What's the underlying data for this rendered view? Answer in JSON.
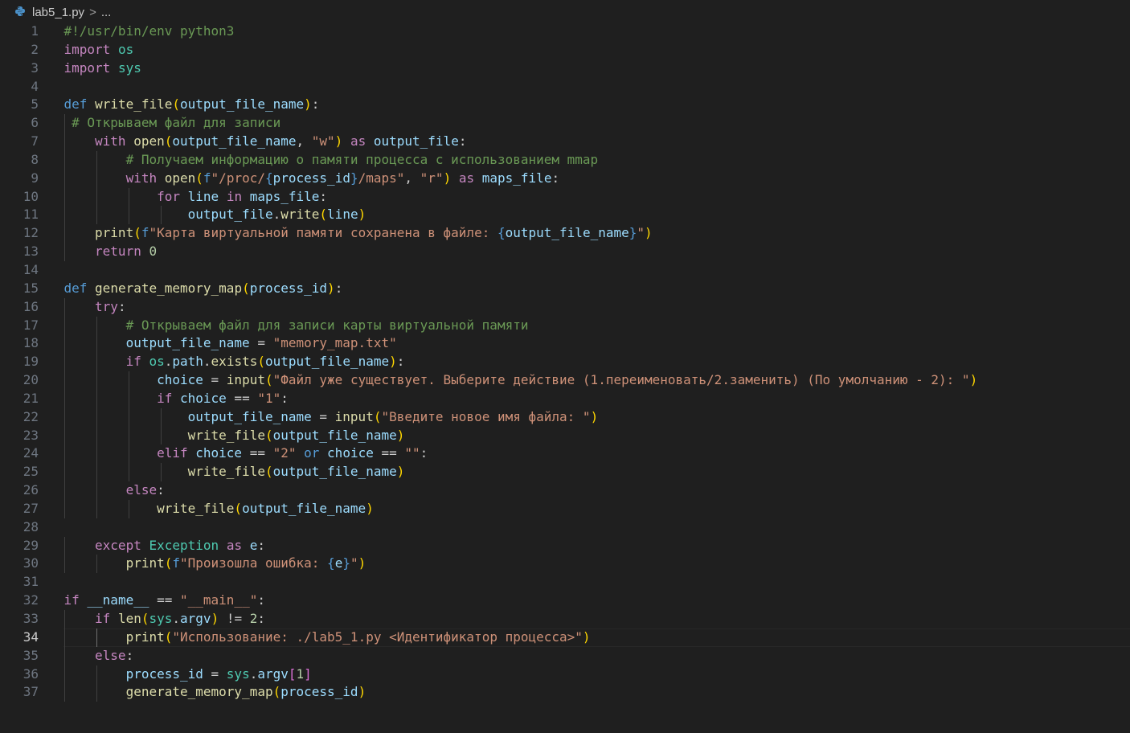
{
  "breadcrumb": {
    "file": "lab5_1.py",
    "sep": ">",
    "more": "..."
  },
  "active_line": 34,
  "lines": [
    {
      "n": "1",
      "indent": 0,
      "t": [
        [
          "c",
          "#!/usr/bin/env python3"
        ]
      ]
    },
    {
      "n": "2",
      "indent": 0,
      "t": [
        [
          "kc",
          "import"
        ],
        [
          "p",
          " "
        ],
        [
          "t",
          "os"
        ]
      ]
    },
    {
      "n": "3",
      "indent": 0,
      "t": [
        [
          "kc",
          "import"
        ],
        [
          "p",
          " "
        ],
        [
          "t",
          "sys"
        ]
      ]
    },
    {
      "n": "4",
      "indent": 0,
      "t": []
    },
    {
      "n": "5",
      "indent": 0,
      "t": [
        [
          "k",
          "def"
        ],
        [
          "p",
          " "
        ],
        [
          "f",
          "write_file"
        ],
        [
          "b1",
          "("
        ],
        [
          "v",
          "output_file_name"
        ],
        [
          "b1",
          ")"
        ],
        [
          "p",
          ":"
        ]
      ]
    },
    {
      "n": "6",
      "indent": 1,
      "t": [
        [
          "p",
          " "
        ],
        [
          "c",
          "# Открываем файл для записи"
        ]
      ]
    },
    {
      "n": "7",
      "indent": 1,
      "t": [
        [
          "p",
          "    "
        ],
        [
          "kc",
          "with"
        ],
        [
          "p",
          " "
        ],
        [
          "f",
          "open"
        ],
        [
          "b1",
          "("
        ],
        [
          "v",
          "output_file_name"
        ],
        [
          "p",
          ", "
        ],
        [
          "s",
          "\"w\""
        ],
        [
          "b1",
          ")"
        ],
        [
          "p",
          " "
        ],
        [
          "kc",
          "as"
        ],
        [
          "p",
          " "
        ],
        [
          "v",
          "output_file"
        ],
        [
          "p",
          ":"
        ]
      ]
    },
    {
      "n": "8",
      "indent": 2,
      "t": [
        [
          "p",
          "        "
        ],
        [
          "c",
          "# Получаем информацию о памяти процесса с использованием mmap"
        ]
      ]
    },
    {
      "n": "9",
      "indent": 2,
      "t": [
        [
          "p",
          "        "
        ],
        [
          "kc",
          "with"
        ],
        [
          "p",
          " "
        ],
        [
          "f",
          "open"
        ],
        [
          "b1",
          "("
        ],
        [
          "k",
          "f"
        ],
        [
          "s",
          "\"/proc/"
        ],
        [
          "sb",
          "{"
        ],
        [
          "v",
          "process_id"
        ],
        [
          "sb",
          "}"
        ],
        [
          "s",
          "/maps\""
        ],
        [
          "p",
          ", "
        ],
        [
          "s",
          "\"r\""
        ],
        [
          "b1",
          ")"
        ],
        [
          "p",
          " "
        ],
        [
          "kc",
          "as"
        ],
        [
          "p",
          " "
        ],
        [
          "v",
          "maps_file"
        ],
        [
          "p",
          ":"
        ]
      ]
    },
    {
      "n": "10",
      "indent": 3,
      "t": [
        [
          "p",
          "            "
        ],
        [
          "kc",
          "for"
        ],
        [
          "p",
          " "
        ],
        [
          "v",
          "line"
        ],
        [
          "p",
          " "
        ],
        [
          "kc",
          "in"
        ],
        [
          "p",
          " "
        ],
        [
          "v",
          "maps_file"
        ],
        [
          "p",
          ":"
        ]
      ]
    },
    {
      "n": "11",
      "indent": 4,
      "t": [
        [
          "p",
          "                "
        ],
        [
          "v",
          "output_file"
        ],
        [
          "p",
          "."
        ],
        [
          "f",
          "write"
        ],
        [
          "b1",
          "("
        ],
        [
          "v",
          "line"
        ],
        [
          "b1",
          ")"
        ]
      ]
    },
    {
      "n": "12",
      "indent": 1,
      "t": [
        [
          "p",
          "    "
        ],
        [
          "f",
          "print"
        ],
        [
          "b1",
          "("
        ],
        [
          "k",
          "f"
        ],
        [
          "s",
          "\"Карта виртуальной памяти сохранена в файле: "
        ],
        [
          "sb",
          "{"
        ],
        [
          "v",
          "output_file_name"
        ],
        [
          "sb",
          "}"
        ],
        [
          "s",
          "\""
        ],
        [
          "b1",
          ")"
        ]
      ]
    },
    {
      "n": "13",
      "indent": 1,
      "t": [
        [
          "p",
          "    "
        ],
        [
          "kc",
          "return"
        ],
        [
          "p",
          " "
        ],
        [
          "n",
          "0"
        ]
      ]
    },
    {
      "n": "14",
      "indent": 0,
      "t": []
    },
    {
      "n": "15",
      "indent": 0,
      "t": [
        [
          "k",
          "def"
        ],
        [
          "p",
          " "
        ],
        [
          "f",
          "generate_memory_map"
        ],
        [
          "b1",
          "("
        ],
        [
          "v",
          "process_id"
        ],
        [
          "b1",
          ")"
        ],
        [
          "p",
          ":"
        ]
      ]
    },
    {
      "n": "16",
      "indent": 1,
      "t": [
        [
          "p",
          "    "
        ],
        [
          "kc",
          "try"
        ],
        [
          "p",
          ":"
        ]
      ]
    },
    {
      "n": "17",
      "indent": 2,
      "t": [
        [
          "p",
          "        "
        ],
        [
          "c",
          "# Открываем файл для записи карты виртуальной памяти"
        ]
      ]
    },
    {
      "n": "18",
      "indent": 2,
      "t": [
        [
          "p",
          "        "
        ],
        [
          "v",
          "output_file_name"
        ],
        [
          "p",
          " = "
        ],
        [
          "s",
          "\"memory_map.txt\""
        ]
      ]
    },
    {
      "n": "19",
      "indent": 2,
      "t": [
        [
          "p",
          "        "
        ],
        [
          "kc",
          "if"
        ],
        [
          "p",
          " "
        ],
        [
          "t",
          "os"
        ],
        [
          "p",
          "."
        ],
        [
          "v",
          "path"
        ],
        [
          "p",
          "."
        ],
        [
          "f",
          "exists"
        ],
        [
          "b1",
          "("
        ],
        [
          "v",
          "output_file_name"
        ],
        [
          "b1",
          ")"
        ],
        [
          "p",
          ":"
        ]
      ]
    },
    {
      "n": "20",
      "indent": 3,
      "t": [
        [
          "p",
          "            "
        ],
        [
          "v",
          "choice"
        ],
        [
          "p",
          " = "
        ],
        [
          "f",
          "input"
        ],
        [
          "b1",
          "("
        ],
        [
          "s",
          "\"Файл уже существует. Выберите действие (1.переименовать/2.заменить) (По умолчанию - 2): \""
        ],
        [
          "b1",
          ")"
        ]
      ]
    },
    {
      "n": "21",
      "indent": 3,
      "t": [
        [
          "p",
          "            "
        ],
        [
          "kc",
          "if"
        ],
        [
          "p",
          " "
        ],
        [
          "v",
          "choice"
        ],
        [
          "p",
          " == "
        ],
        [
          "s",
          "\"1\""
        ],
        [
          "p",
          ":"
        ]
      ]
    },
    {
      "n": "22",
      "indent": 4,
      "t": [
        [
          "p",
          "                "
        ],
        [
          "v",
          "output_file_name"
        ],
        [
          "p",
          " = "
        ],
        [
          "f",
          "input"
        ],
        [
          "b1",
          "("
        ],
        [
          "s",
          "\"Введите новое имя файла: \""
        ],
        [
          "b1",
          ")"
        ]
      ]
    },
    {
      "n": "23",
      "indent": 4,
      "t": [
        [
          "p",
          "                "
        ],
        [
          "f",
          "write_file"
        ],
        [
          "b1",
          "("
        ],
        [
          "v",
          "output_file_name"
        ],
        [
          "b1",
          ")"
        ]
      ]
    },
    {
      "n": "24",
      "indent": 3,
      "t": [
        [
          "p",
          "            "
        ],
        [
          "kc",
          "elif"
        ],
        [
          "p",
          " "
        ],
        [
          "v",
          "choice"
        ],
        [
          "p",
          " == "
        ],
        [
          "s",
          "\"2\""
        ],
        [
          "p",
          " "
        ],
        [
          "k",
          "or"
        ],
        [
          "p",
          " "
        ],
        [
          "v",
          "choice"
        ],
        [
          "p",
          " == "
        ],
        [
          "s",
          "\"\""
        ],
        [
          "p",
          ":"
        ]
      ]
    },
    {
      "n": "25",
      "indent": 4,
      "t": [
        [
          "p",
          "                "
        ],
        [
          "f",
          "write_file"
        ],
        [
          "b1",
          "("
        ],
        [
          "v",
          "output_file_name"
        ],
        [
          "b1",
          ")"
        ]
      ]
    },
    {
      "n": "26",
      "indent": 2,
      "t": [
        [
          "p",
          "        "
        ],
        [
          "kc",
          "else"
        ],
        [
          "p",
          ":"
        ]
      ]
    },
    {
      "n": "27",
      "indent": 3,
      "t": [
        [
          "p",
          "            "
        ],
        [
          "f",
          "write_file"
        ],
        [
          "b1",
          "("
        ],
        [
          "v",
          "output_file_name"
        ],
        [
          "b1",
          ")"
        ]
      ]
    },
    {
      "n": "28",
      "indent": 0,
      "t": []
    },
    {
      "n": "29",
      "indent": 1,
      "t": [
        [
          "p",
          "    "
        ],
        [
          "kc",
          "except"
        ],
        [
          "p",
          " "
        ],
        [
          "t",
          "Exception"
        ],
        [
          "p",
          " "
        ],
        [
          "kc",
          "as"
        ],
        [
          "p",
          " "
        ],
        [
          "v",
          "e"
        ],
        [
          "p",
          ":"
        ]
      ]
    },
    {
      "n": "30",
      "indent": 2,
      "t": [
        [
          "p",
          "        "
        ],
        [
          "f",
          "print"
        ],
        [
          "b1",
          "("
        ],
        [
          "k",
          "f"
        ],
        [
          "s",
          "\"Произошла ошибка: "
        ],
        [
          "sb",
          "{"
        ],
        [
          "v",
          "e"
        ],
        [
          "sb",
          "}"
        ],
        [
          "s",
          "\""
        ],
        [
          "b1",
          ")"
        ]
      ]
    },
    {
      "n": "31",
      "indent": 0,
      "t": []
    },
    {
      "n": "32",
      "indent": 0,
      "t": [
        [
          "kc",
          "if"
        ],
        [
          "p",
          " "
        ],
        [
          "v",
          "__name__"
        ],
        [
          "p",
          " == "
        ],
        [
          "s",
          "\"__main__\""
        ],
        [
          "p",
          ":"
        ]
      ]
    },
    {
      "n": "33",
      "indent": 1,
      "t": [
        [
          "p",
          "    "
        ],
        [
          "kc",
          "if"
        ],
        [
          "p",
          " "
        ],
        [
          "f",
          "len"
        ],
        [
          "b1",
          "("
        ],
        [
          "t",
          "sys"
        ],
        [
          "p",
          "."
        ],
        [
          "v",
          "argv"
        ],
        [
          "b1",
          ")"
        ],
        [
          "p",
          " != "
        ],
        [
          "n",
          "2"
        ],
        [
          "p",
          ":"
        ]
      ]
    },
    {
      "n": "34",
      "indent": 2,
      "t": [
        [
          "p",
          "        "
        ],
        [
          "f",
          "print"
        ],
        [
          "b1",
          "("
        ],
        [
          "s",
          "\"Использование: ./lab5_1.py <Идентификатор процесса>\""
        ],
        [
          "b1",
          ")"
        ]
      ]
    },
    {
      "n": "35",
      "indent": 1,
      "t": [
        [
          "p",
          "    "
        ],
        [
          "kc",
          "else"
        ],
        [
          "p",
          ":"
        ]
      ]
    },
    {
      "n": "36",
      "indent": 2,
      "t": [
        [
          "p",
          "        "
        ],
        [
          "v",
          "process_id"
        ],
        [
          "p",
          " = "
        ],
        [
          "t",
          "sys"
        ],
        [
          "p",
          "."
        ],
        [
          "v",
          "argv"
        ],
        [
          "b2",
          "["
        ],
        [
          "n",
          "1"
        ],
        [
          "b2",
          "]"
        ]
      ]
    },
    {
      "n": "37",
      "indent": 2,
      "t": [
        [
          "p",
          "        "
        ],
        [
          "f",
          "generate_memory_map"
        ],
        [
          "b1",
          "("
        ],
        [
          "v",
          "process_id"
        ],
        [
          "b1",
          ")"
        ]
      ]
    }
  ]
}
